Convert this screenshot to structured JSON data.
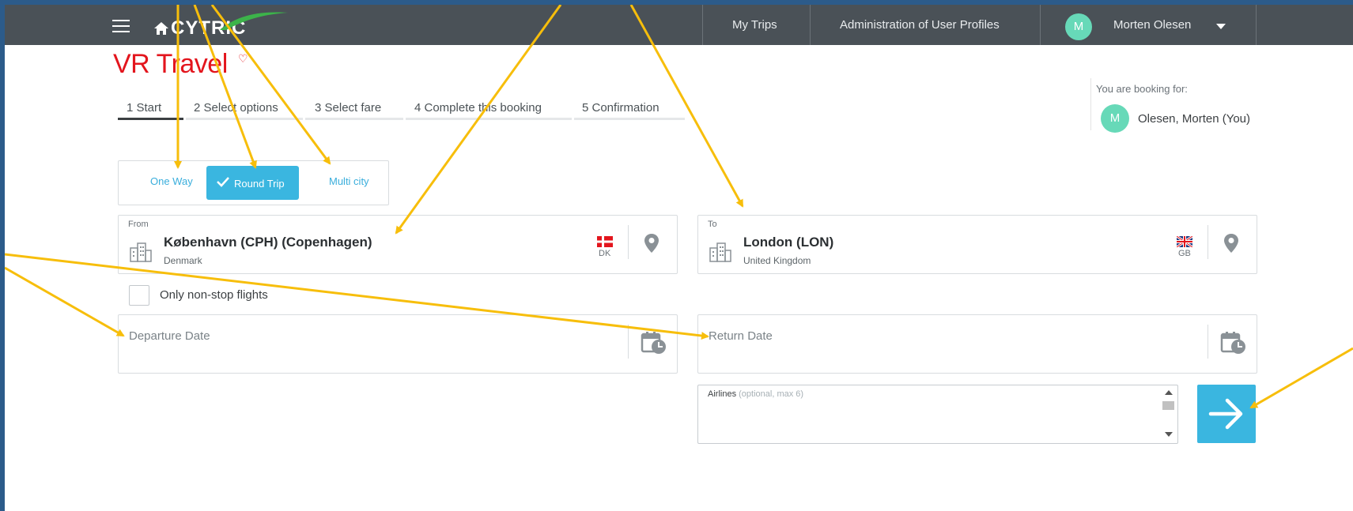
{
  "header": {
    "logo_text": "CYTRIC",
    "nav": {
      "my_trips": "My Trips",
      "admin_profiles": "Administration of User Profiles"
    },
    "user": {
      "initial": "M",
      "name": "Morten Olesen"
    }
  },
  "brand": {
    "name": "VR Travel"
  },
  "steps": [
    {
      "label": "1  Start"
    },
    {
      "label": "2  Select options"
    },
    {
      "label": "3  Select fare"
    },
    {
      "label": "4  Complete this booking"
    },
    {
      "label": "5  Confirmation"
    }
  ],
  "booking_for": {
    "label": "You are booking for:",
    "initial": "M",
    "name": "Olesen, Morten (You)"
  },
  "trip_type": {
    "one_way": "One Way",
    "round_trip": "Round Trip",
    "multi_city": "Multi city",
    "selected": "Round Trip"
  },
  "from": {
    "label": "From",
    "city": "København (CPH) (Copenhagen)",
    "country": "Denmark",
    "flag_code": "DK"
  },
  "to": {
    "label": "To",
    "city": "London (LON)",
    "country": "United Kingdom",
    "flag_code": "GB"
  },
  "nonstop": {
    "label": "Only non-stop flights",
    "checked": false
  },
  "departure": {
    "placeholder": "Departure Date"
  },
  "return": {
    "placeholder": "Return Date"
  },
  "airlines": {
    "label": "Airlines",
    "hint": "(optional, max 6)"
  },
  "colors": {
    "topbar": "#4a5157",
    "accent": "#3ab6e0",
    "brand_red": "#e3151d",
    "avatar": "#67d9b8",
    "annotation": "#f7be0b",
    "outer_background": "#2c5b8a"
  }
}
